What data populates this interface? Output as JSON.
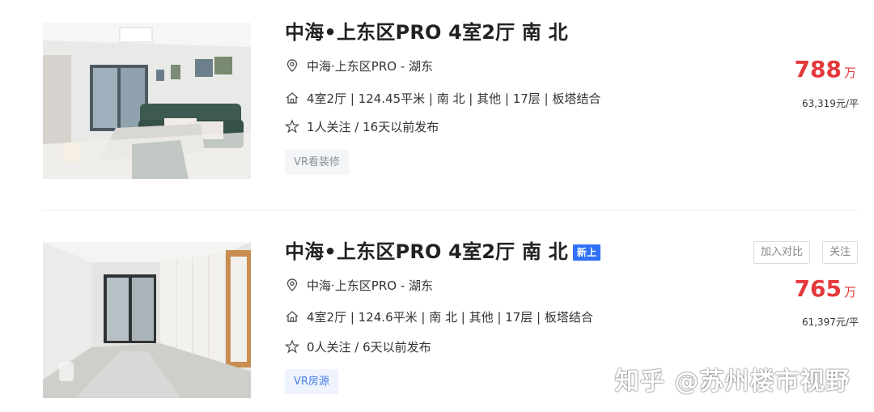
{
  "listings": [
    {
      "title": "中海•上东区PRO 4室2厅 南 北",
      "badge": "",
      "location": "中海·上东区PRO - 湖东",
      "info": "4室2厅 | 124.45平米 | 南 北 | 其他 | 17层 | 板塔结合",
      "follow": "1人关注 / 16天以前发布",
      "tag": "VR看装修",
      "price": "788",
      "price_unit": "万",
      "unit_price": "63,319元/平"
    },
    {
      "title": "中海•上东区PRO 4室2厅 南 北",
      "badge": "新上",
      "location": "中海·上东区PRO - 湖东",
      "info": "4室2厅 | 124.6平米 | 南 北 | 其他 | 17层 | 板塔结合",
      "follow": "0人关注 / 6天以前发布",
      "tag": "VR房源",
      "price": "765",
      "price_unit": "万",
      "unit_price": "61,397元/平",
      "actions": {
        "compare": "加入对比",
        "follow": "关注"
      }
    }
  ],
  "watermark": "知乎 @苏州楼市视野",
  "colors": {
    "price": "#e4393c",
    "badge": "#3072f6",
    "vr_tag_text": "#4a7ee6"
  },
  "icons": {
    "location": "location-pin-icon",
    "house": "house-icon",
    "star": "star-icon"
  }
}
